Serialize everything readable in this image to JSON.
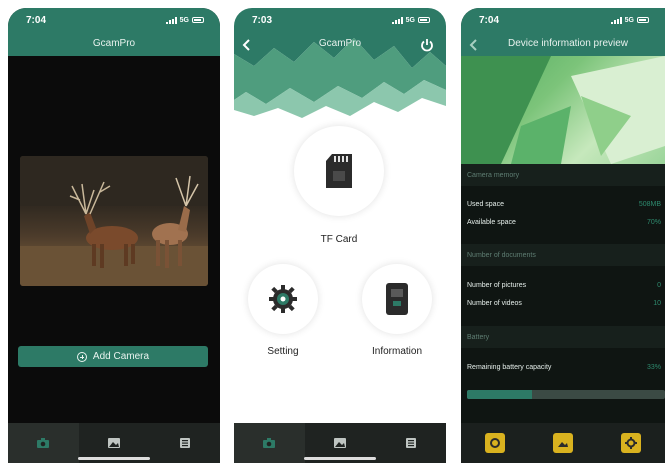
{
  "phone1": {
    "status": {
      "time": "7:04",
      "network": "5G"
    },
    "title": "GcamPro",
    "add_camera_label": "Add Camera",
    "tabs": [
      {
        "icon": "camera-icon",
        "active": true
      },
      {
        "icon": "picture-icon",
        "active": false
      },
      {
        "icon": "list-icon",
        "active": false
      }
    ]
  },
  "phone2": {
    "status": {
      "time": "7:03",
      "network": "5G"
    },
    "title": "GcamPro",
    "tf_card_label": "TF Card",
    "setting_label": "Setting",
    "information_label": "Information",
    "tabs": [
      {
        "icon": "camera-icon",
        "active": true
      },
      {
        "icon": "picture-icon",
        "active": false
      },
      {
        "icon": "list-icon",
        "active": false
      }
    ]
  },
  "phone3": {
    "status": {
      "time": "7:04",
      "network": "5G"
    },
    "title": "Device information preview",
    "sections": {
      "memory": "Camera memory",
      "documents": "Number of documents",
      "battery": "Battery"
    },
    "rows": {
      "used_space": {
        "label": "Used space",
        "value": "508MB"
      },
      "available_space": {
        "label": "Available space",
        "value": "70%"
      },
      "pictures": {
        "label": "Number of pictures",
        "value": "0"
      },
      "videos": {
        "label": "Number of videos",
        "value": "10"
      },
      "battery": {
        "label": "Remaining battery capacity",
        "value": "33%"
      }
    },
    "battery_level": 0.33,
    "bottom_icons": [
      "camera-icon",
      "picture-icon",
      "gear-icon"
    ]
  },
  "colors": {
    "brand": "#2d7a66",
    "dark": "#0f1512",
    "accent_yellow": "#d9b21f"
  }
}
